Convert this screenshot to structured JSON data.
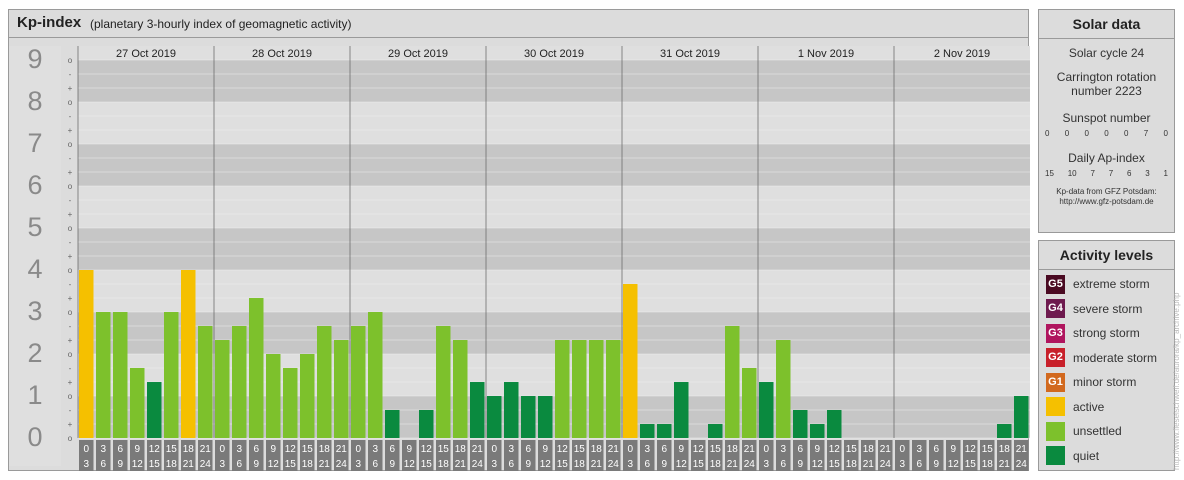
{
  "title": "Kp-index",
  "subtitle": "(planetary 3-hourly index of geomagnetic activity)",
  "chart_data": {
    "type": "bar",
    "y_levels": [
      "0",
      "1",
      "2",
      "3",
      "4",
      "5",
      "6",
      "7",
      "8",
      "9"
    ],
    "y_subticks": [
      "o",
      "+",
      "-",
      "o",
      "+",
      "-",
      "o",
      "+",
      "-",
      "o",
      "+",
      "-",
      "o",
      "+",
      "-",
      "o",
      "+",
      "-",
      "o",
      "+",
      "-",
      "o",
      "+",
      "-",
      "o",
      "+",
      "-",
      "o"
    ],
    "ylim": [
      0,
      9
    ],
    "days": [
      "27 Oct 2019",
      "28 Oct 2019",
      "29 Oct 2019",
      "30 Oct 2019",
      "31 Oct 2019",
      "1 Nov 2019",
      "2 Nov 2019"
    ],
    "interval_starts": [
      "0",
      "3",
      "6",
      "9",
      "12",
      "15",
      "18",
      "21"
    ],
    "interval_ends": [
      "3",
      "6",
      "9",
      "12",
      "15",
      "18",
      "21",
      "24"
    ],
    "values": [
      4.0,
      3.0,
      3.0,
      1.667,
      1.333,
      3.0,
      4.0,
      2.667,
      2.333,
      2.667,
      3.333,
      2.0,
      1.667,
      2.0,
      2.667,
      2.333,
      2.667,
      3.0,
      0.667,
      0.0,
      0.667,
      2.667,
      2.333,
      1.333,
      1.0,
      1.333,
      1.0,
      1.0,
      2.333,
      2.333,
      2.333,
      2.333,
      3.667,
      0.333,
      0.333,
      1.333,
      0.0,
      0.333,
      2.667,
      1.667,
      1.333,
      2.333,
      0.667,
      0.333,
      0.667,
      0.0,
      0.0,
      0.0,
      0.0,
      0.0,
      0.0,
      0.0,
      0.0,
      0.0,
      0.333,
      1.0
    ],
    "levels": [
      "active",
      "unsettled",
      "unsettled",
      "unsettled",
      "quiet",
      "unsettled",
      "active",
      "unsettled",
      "unsettled",
      "unsettled",
      "unsettled",
      "unsettled",
      "unsettled",
      "unsettled",
      "unsettled",
      "unsettled",
      "unsettled",
      "unsettled",
      "quiet",
      "quiet",
      "quiet",
      "unsettled",
      "unsettled",
      "quiet",
      "quiet",
      "quiet",
      "quiet",
      "quiet",
      "unsettled",
      "unsettled",
      "unsettled",
      "unsettled",
      "active",
      "quiet",
      "quiet",
      "quiet",
      "quiet",
      "quiet",
      "unsettled",
      "unsettled",
      "quiet",
      "unsettled",
      "quiet",
      "quiet",
      "quiet",
      "quiet",
      "quiet",
      "quiet",
      "quiet",
      "quiet",
      "quiet",
      "quiet",
      "quiet",
      "quiet",
      "quiet",
      "quiet"
    ]
  },
  "colors": {
    "active": "#f5c000",
    "unsettled": "#7dc12c",
    "quiet": "#0a8a3f",
    "g1": "#d2691e",
    "g2": "#c8202a",
    "g3": "#b0155e",
    "g4": "#6e1a4e",
    "g5": "#4a0a22",
    "band_dark": "#c6c6c6",
    "band_light": "#dfdfdf",
    "grid_line": "#f0f0f0",
    "axis_label": "#8a8a8a",
    "tick_box": "#7a7a7a"
  },
  "solar": {
    "heading": "Solar data",
    "cycle": "Solar cycle 24",
    "carrington_1": "Carrington rotation",
    "carrington_2": "number 2223",
    "sunspot_label": "Sunspot number",
    "sunspot_values": [
      "0",
      "0",
      "0",
      "0",
      "0",
      "7",
      "0"
    ],
    "ap_label": "Daily Ap-index",
    "ap_values": [
      "15",
      "10",
      "7",
      "7",
      "6",
      "3",
      "1"
    ],
    "credit_1": "Kp-data from GFZ Potsdam:",
    "credit_2": "http://www.gfz-potsdam.de"
  },
  "activity": {
    "heading": "Activity levels",
    "items": [
      {
        "code": "G5",
        "label": "extreme storm",
        "color": "#4a0a22"
      },
      {
        "code": "G4",
        "label": "severe storm",
        "color": "#6e1a4e"
      },
      {
        "code": "G3",
        "label": "strong storm",
        "color": "#b0155e"
      },
      {
        "code": "G2",
        "label": "moderate storm",
        "color": "#c8202a"
      },
      {
        "code": "G1",
        "label": "minor storm",
        "color": "#d2691e"
      },
      {
        "code": "",
        "label": "active",
        "color": "#f5c000"
      },
      {
        "code": "",
        "label": "unsettled",
        "color": "#7dc12c"
      },
      {
        "code": "",
        "label": "quiet",
        "color": "#0a8a3f"
      }
    ]
  },
  "watermark": "http://www.fieselschweif.de/aurora/kp_archive.php"
}
